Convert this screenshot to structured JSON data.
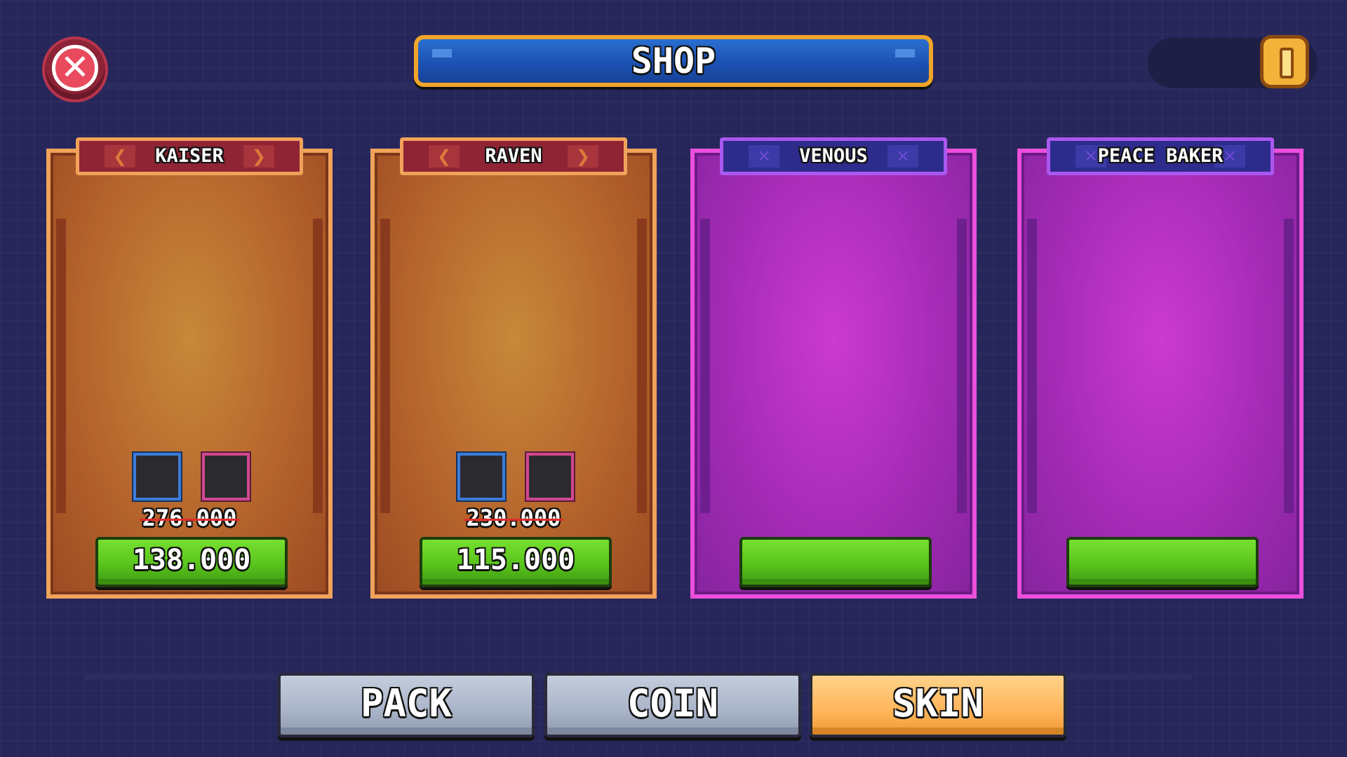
{
  "header": {
    "title": "SHOP",
    "close_icon": "close-icon",
    "coin_icon": "coin-icon",
    "coin_balance": ""
  },
  "cards": [
    {
      "name": "KAISER",
      "theme": "orange",
      "old_price": "276.000",
      "price": "138.000"
    },
    {
      "name": "RAVEN",
      "theme": "orange",
      "old_price": "230.000",
      "price": "115.000"
    },
    {
      "name": "VENOUS",
      "theme": "purple",
      "old_price": "",
      "price": ""
    },
    {
      "name": "PEACE BAKER",
      "theme": "purple",
      "old_price": "",
      "price": ""
    }
  ],
  "tabs": [
    {
      "label": "PACK",
      "active": false
    },
    {
      "label": "COIN",
      "active": false
    },
    {
      "label": "SKIN",
      "active": true
    }
  ],
  "colors": {
    "background": "#27265a",
    "orange_card": "#b5642c",
    "purple_card": "#a52bb6",
    "buy_button": "#5ac41d",
    "active_tab": "#ffb55a",
    "inactive_tab": "#aab4c8",
    "title_banner": "#1b4fb0",
    "title_border": "#f0a52a"
  }
}
